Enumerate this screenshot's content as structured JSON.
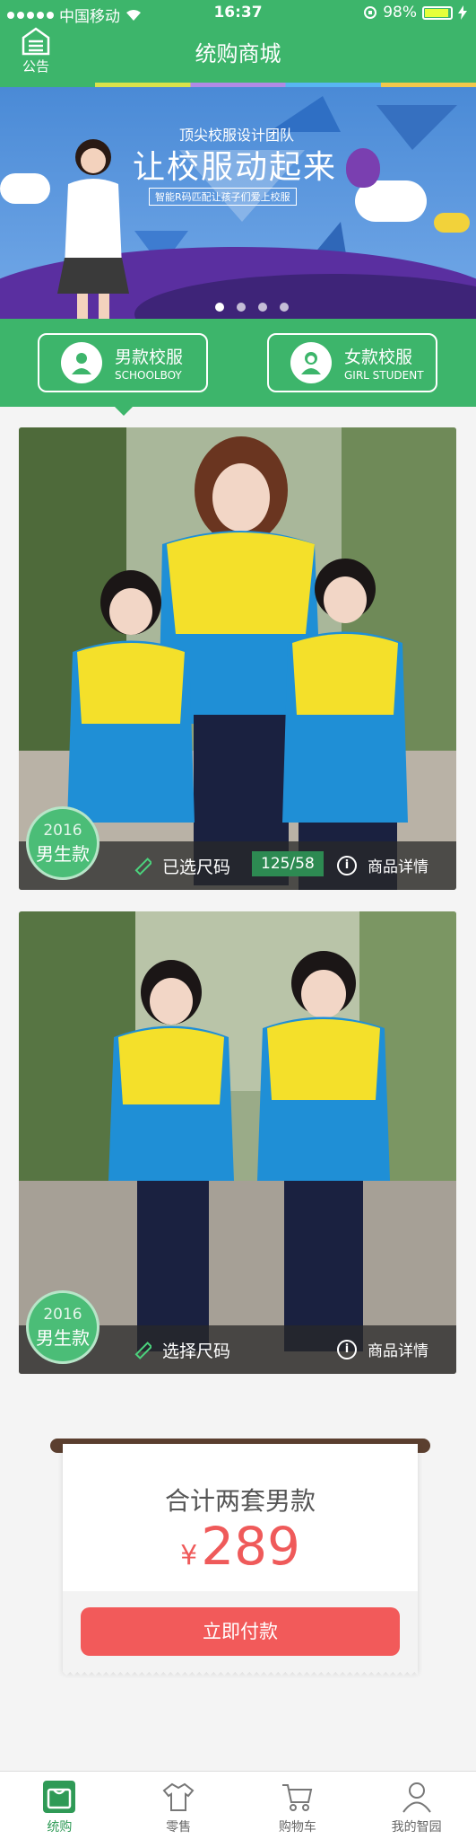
{
  "status": {
    "carrier": "中国移动",
    "time": "16:37",
    "battery": "98%"
  },
  "nav": {
    "notice_label": "公告",
    "title": "统购商城"
  },
  "banner": {
    "subtitle": "顶尖校服设计团队",
    "headline": "让校服动起来",
    "tagline": "智能R码匹配让孩子们爱上校服",
    "pages": 4,
    "active_page": 1
  },
  "categories": [
    {
      "zh": "男款校服",
      "en": "SCHOOLBOY"
    },
    {
      "zh": "女款校服",
      "en": "GIRL STUDENT"
    }
  ],
  "products": [
    {
      "year": "2016",
      "label": "男生款",
      "size_action": "已选尺码",
      "size_value": "125/58",
      "detail": "商品详情"
    },
    {
      "year": "2016",
      "label": "男生款",
      "size_action": "选择尺码",
      "size_value": "",
      "detail": "商品详情"
    }
  ],
  "checkout": {
    "summary": "合计两套男款",
    "currency": "¥",
    "amount": "289",
    "pay_label": "立即付款"
  },
  "tabbar": [
    {
      "label": "统购",
      "icon": "bag-icon",
      "active": true
    },
    {
      "label": "零售",
      "icon": "shirt-icon",
      "active": false
    },
    {
      "label": "购物车",
      "icon": "cart-icon",
      "active": false
    },
    {
      "label": "我的智园",
      "icon": "user-icon",
      "active": false
    }
  ],
  "colors": {
    "brand_green": "#3db56b",
    "price_red": "#ef5a5a",
    "pay_button": "#f25a5a"
  }
}
